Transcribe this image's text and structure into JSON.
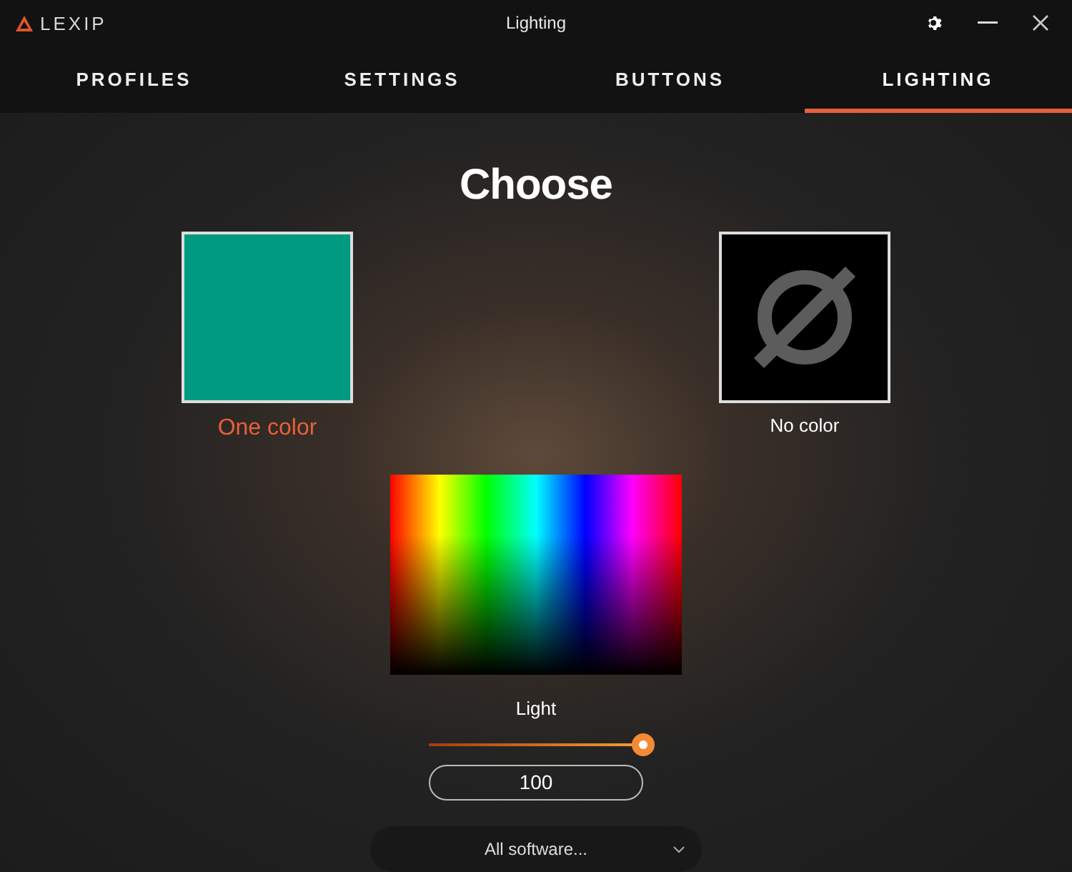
{
  "window": {
    "logo": "LEXIP",
    "title": "Lighting"
  },
  "tabs": [
    {
      "label": "PROFILES",
      "selected": false
    },
    {
      "label": "SETTINGS",
      "selected": false
    },
    {
      "label": "BUTTONS",
      "selected": false
    },
    {
      "label": "LIGHTING",
      "selected": true
    }
  ],
  "heading": "Choose",
  "options": [
    {
      "kind": "color",
      "label": "One color",
      "color": "#009a80",
      "selected": true
    },
    {
      "kind": "none",
      "label": "No color",
      "selected": false
    }
  ],
  "light": {
    "label": "Light",
    "level": 1,
    "value": "100"
  },
  "software": {
    "value": "All software..."
  }
}
